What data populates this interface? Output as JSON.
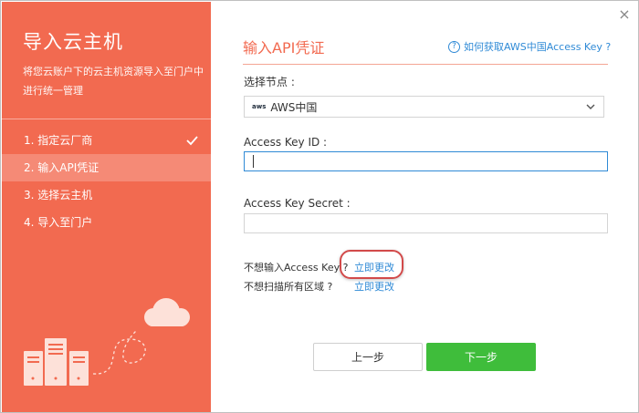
{
  "sidebar": {
    "title": "导入云主机",
    "description": "将您云账户下的云主机资源导入至门户中进行统一管理",
    "steps": [
      {
        "label": "1. 指定云厂商",
        "done": true
      },
      {
        "label": "2. 输入API凭证",
        "active": true
      },
      {
        "label": "3. 选择云主机"
      },
      {
        "label": "4. 导入至门户"
      }
    ]
  },
  "main": {
    "heading": "输入API凭证",
    "help_link": "如何获取AWS中国Access Key ?",
    "region_label": "选择节点 :",
    "region_value": "AWS中国",
    "region_logo_text": "aws",
    "access_key_id_label": "Access Key ID :",
    "access_key_id_value": "",
    "access_key_secret_label": "Access Key Secret :",
    "access_key_secret_value": "",
    "no_access_key_text": "不想输入Access Key ?",
    "no_access_key_link": "立即更改",
    "no_scan_text": "不想扫描所有区域 ?",
    "no_scan_link": "立即更改",
    "prev_button": "上一步",
    "next_button": "下一步",
    "close_glyph": "×"
  },
  "colors": {
    "accent": "#f26a50",
    "link": "#2f8ad6",
    "primary_button": "#3fbd3b"
  }
}
